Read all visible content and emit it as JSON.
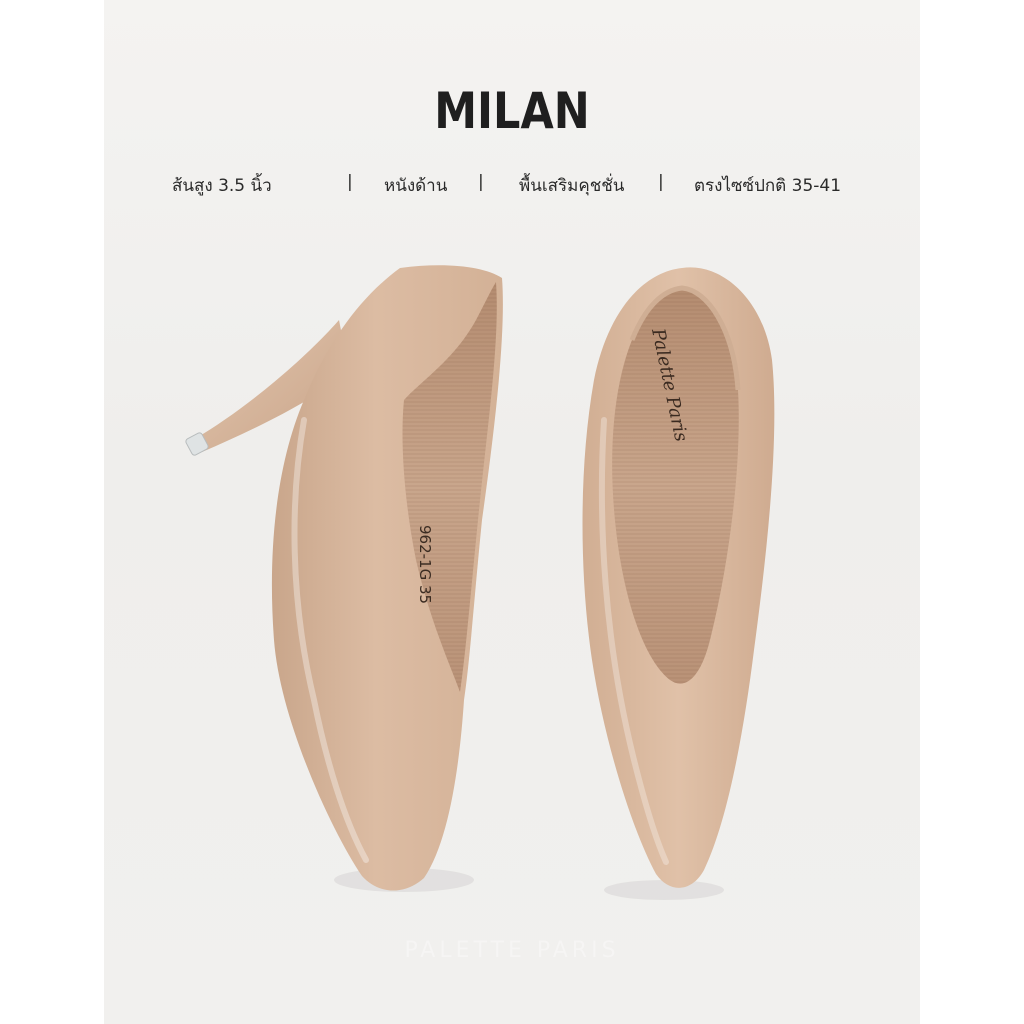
{
  "product": {
    "title": "MILAN",
    "features": [
      "ส้นสูง 3.5 นิ้ว",
      "หนังด้าน",
      "พื้นเสริมคุชชั่น",
      "ตรงไซซ์ปกติ 35-41"
    ],
    "separator": "|"
  },
  "shoe": {
    "insole_print": "962-1G 35",
    "brand_script": "Palette Paris",
    "color": "#d9b9a0"
  },
  "watermark": "PALETTE PARIS",
  "colors": {
    "background": "#f1f0ee",
    "shoe_leather": "#d9b9a0",
    "insole": "#c8a489",
    "text": "#1f1f1f"
  }
}
